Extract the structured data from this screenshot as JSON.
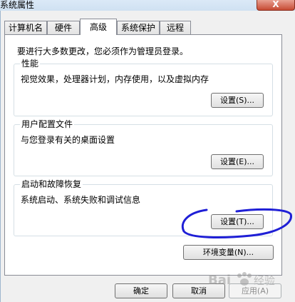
{
  "window": {
    "title": "系统属性",
    "close_label": "X"
  },
  "tabs": [
    {
      "label": "计算机名"
    },
    {
      "label": "硬件"
    },
    {
      "label": "高级"
    },
    {
      "label": "系统保护"
    },
    {
      "label": "远程"
    }
  ],
  "active_tab": "高级",
  "panel": {
    "intro": "要进行大多数更改，您必须作为管理员登录。",
    "groups": [
      {
        "title": "性能",
        "description": "视觉效果，处理器计划，内存使用，以及虚拟内存",
        "button": "设置(S)..."
      },
      {
        "title": "用户配置文件",
        "description": "与您登录有关的桌面设置",
        "button": "设置(E)..."
      },
      {
        "title": "启动和故障恢复",
        "description": "系统启动、系统失败和调试信息",
        "button": "设置(T)..."
      }
    ],
    "env_button": "环境变量(N)..."
  },
  "footer": {
    "ok": "确定",
    "cancel": "取消",
    "apply": "应用(A)"
  },
  "watermark": "Bai 经验",
  "colors": {
    "annotation": "#1f1fd6",
    "titlebar": "#c8dcef",
    "close": "#c64a33"
  }
}
